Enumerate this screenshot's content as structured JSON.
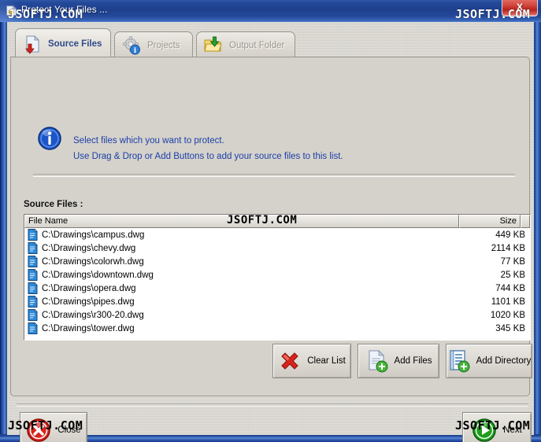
{
  "window": {
    "title": "Protect Your Files ...",
    "icon": "app-shield-icon",
    "close_label": "X"
  },
  "watermarks": {
    "top_left": "JSOFTJ.COM",
    "top_right": "JSOFTJ.COM",
    "middle": "JSOFTJ.COM",
    "bottom_left": "JSOFTJ.COM",
    "bottom_right": "JSOFTJ.COM"
  },
  "tabs": [
    {
      "label": "Source Files",
      "icon": "document-down-arrow-icon",
      "active": true
    },
    {
      "label": "Projects",
      "icon": "gear-info-icon",
      "active": false
    },
    {
      "label": "Output Folder",
      "icon": "folder-down-arrow-icon",
      "active": false
    }
  ],
  "info": {
    "icon": "information-icon",
    "line1": "Select files which you want to protect.",
    "line2": "Use Drag & Drop or Add Buttons to add your source files to this list."
  },
  "list": {
    "caption": "Source Files :",
    "columns": [
      "File Name",
      "Size"
    ],
    "rows": [
      {
        "icon": "file-icon",
        "name": "C:\\Drawings\\campus.dwg",
        "size": "449 KB"
      },
      {
        "icon": "file-icon",
        "name": "C:\\Drawings\\chevy.dwg",
        "size": "2114 KB"
      },
      {
        "icon": "file-icon",
        "name": "C:\\Drawings\\colorwh.dwg",
        "size": "77 KB"
      },
      {
        "icon": "file-icon",
        "name": "C:\\Drawings\\downtown.dwg",
        "size": "25 KB"
      },
      {
        "icon": "file-icon",
        "name": "C:\\Drawings\\opera.dwg",
        "size": "744 KB"
      },
      {
        "icon": "file-icon",
        "name": "C:\\Drawings\\pipes.dwg",
        "size": "1101 KB"
      },
      {
        "icon": "file-icon",
        "name": "C:\\Drawings\\r300-20.dwg",
        "size": "1020 KB"
      },
      {
        "icon": "file-icon",
        "name": "C:\\Drawings\\tower.dwg",
        "size": "345 KB"
      }
    ]
  },
  "actions": {
    "clear_list": {
      "label": "Clear List",
      "icon": "red-x-icon"
    },
    "add_files": {
      "label": "Add Files",
      "icon": "document-plus-icon"
    },
    "add_dir": {
      "label": "Add Directory",
      "icon": "list-document-plus-icon"
    }
  },
  "footer": {
    "close": {
      "label": "Close",
      "icon": "red-circle-x-icon"
    },
    "next": {
      "label": "Next",
      "icon": "green-play-icon"
    }
  },
  "colors": {
    "titlebar_blue": "#1e3f8d",
    "face": "#d5d2cb",
    "link_blue": "#1b3fa8",
    "active_tab_text": "#2d4a8a",
    "inactive_tab_text": "#9a9790",
    "close_red": "#b4231c",
    "next_green": "#1e9e1e"
  }
}
